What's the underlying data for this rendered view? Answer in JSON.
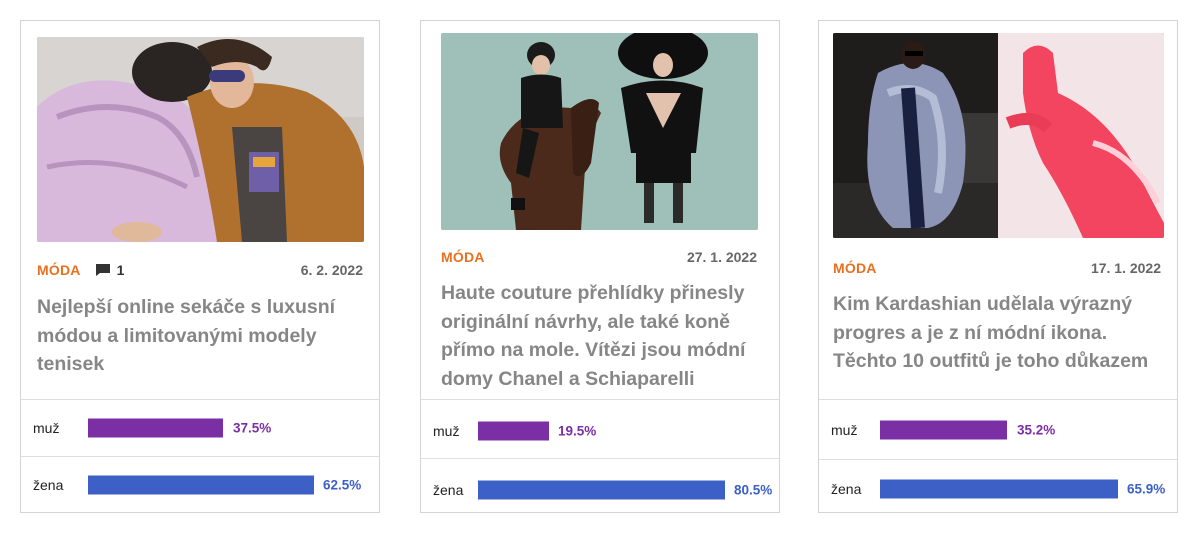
{
  "cards": [
    {
      "category": "MÓDA",
      "comments": "1",
      "date": "6. 2. 2022",
      "title": "Nejlepší online sekáče s luxusní módou a limitovanými modely tenisek",
      "image": "fashion-puffer-jackets-photo",
      "stats": [
        {
          "label": "muž",
          "percent": "37.5%",
          "value": 37.5
        },
        {
          "label": "žena",
          "percent": "62.5%",
          "value": 62.5
        }
      ]
    },
    {
      "category": "MÓDA",
      "date": "27. 1. 2022",
      "title": "Haute couture přehlídky přinesly originální návrhy, ale také koně přímo na mole. Vítězi jsou módní domy Chanel a Schiaparelli",
      "image": "runway-horse-model-photo",
      "stats": [
        {
          "label": "muž",
          "percent": "19.5%",
          "value": 19.5
        },
        {
          "label": "žena",
          "percent": "80.5%",
          "value": 80.5
        }
      ]
    },
    {
      "category": "MÓDA",
      "date": "17. 1. 2022",
      "title": "Kim Kardashian udělala výrazný progres a je z ní módní ikona. Těchto 10 outfitů je toho důkazem",
      "image": "kim-kardashian-outfits-photo",
      "stats": [
        {
          "label": "muž",
          "percent": "35.2%",
          "value": 35.2
        },
        {
          "label": "žena",
          "percent": "65.9%",
          "value": 65.9
        }
      ]
    }
  ],
  "colors": {
    "category": "#e8701e",
    "male": "#7b2fa4",
    "female": "#3d60c7",
    "title": "#868686"
  }
}
